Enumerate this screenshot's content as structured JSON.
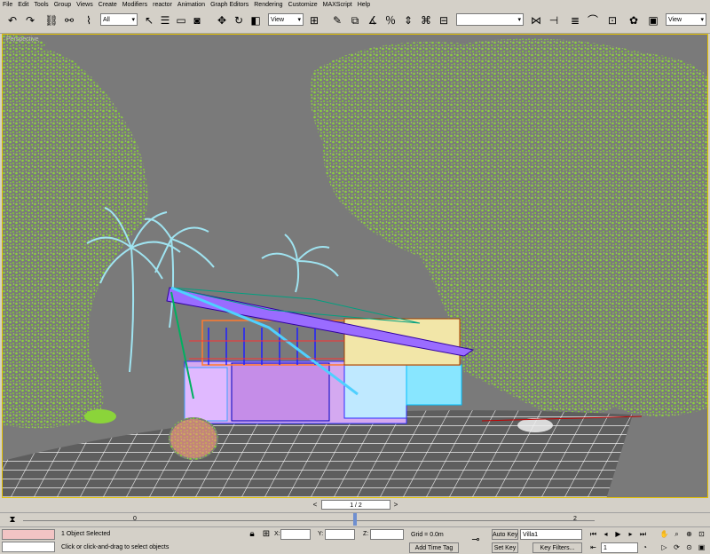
{
  "menu": [
    "File",
    "Edit",
    "Tools",
    "Group",
    "Views",
    "Create",
    "Modifiers",
    "reactor",
    "Animation",
    "Graph Editors",
    "Rendering",
    "Customize",
    "MAXScript",
    "Help"
  ],
  "toolbar": {
    "selection_filter": "All",
    "ref_coord": "View",
    "named_selection": "",
    "render_type": "View"
  },
  "viewport": {
    "label": "Perspective"
  },
  "timeslider": {
    "frame": "1 / 2",
    "prev": "<",
    "next": ">"
  },
  "trackbar": {
    "tick_0": "0",
    "tick_2": "2"
  },
  "status": {
    "selection": "1 Object Selected",
    "prompt": "Click or click-and-drag to select objects",
    "x_label": "X:",
    "y_label": "Y:",
    "z_label": "Z:",
    "x_value": "",
    "y_value": "",
    "z_value": "",
    "grid": "Grid = 0.0m",
    "add_time_tag": "Add Time Tag",
    "auto_key": "Auto Key",
    "set_key": "Set Key",
    "key_set": "Villa1",
    "key_filters": "Key Filters...",
    "current_frame": "1"
  },
  "colors": {
    "ui_bg": "#d4d0c8",
    "viewport_bg": "#7a7a7a",
    "viewport_border": "#e6c200",
    "foliage": "#8bd43a",
    "palm": "#9fe3f0",
    "ground_grid": "#ffffff"
  }
}
